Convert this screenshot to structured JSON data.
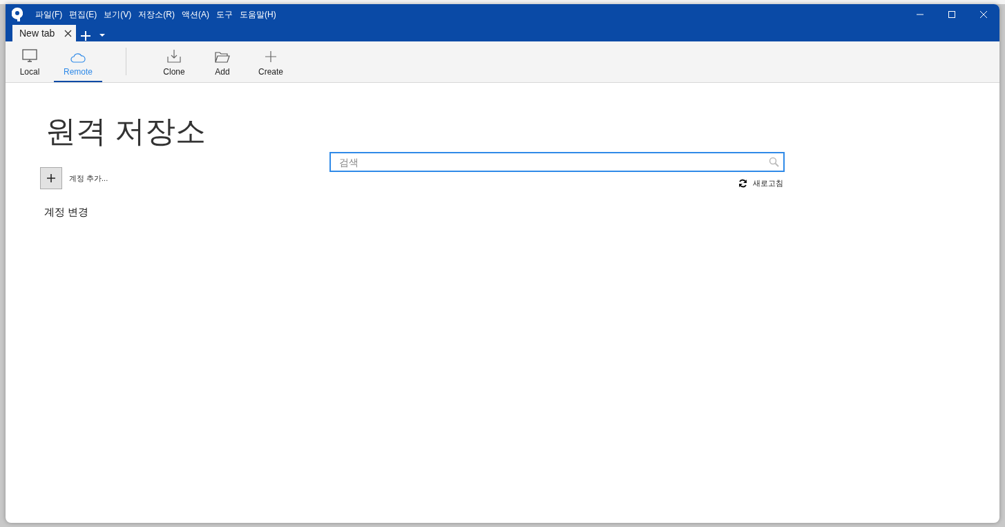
{
  "menu": [
    {
      "label": "파일(F)"
    },
    {
      "label": "편집(E)"
    },
    {
      "label": "보기(V)"
    },
    {
      "label": "저장소(R)"
    },
    {
      "label": "액션(A)"
    },
    {
      "label": "도구"
    },
    {
      "label": "도움말(H)"
    }
  ],
  "tabs": [
    {
      "label": "New tab",
      "selected": true
    }
  ],
  "toolbar": {
    "views": [
      {
        "label": "Local",
        "selected": false
      },
      {
        "label": "Remote",
        "selected": true
      }
    ],
    "actions": [
      {
        "label": "Clone"
      },
      {
        "label": "Add"
      },
      {
        "label": "Create"
      }
    ]
  },
  "page": {
    "title": "원격 저장소",
    "add_account": "계정 추가...",
    "section": "계정 변경",
    "search": {
      "placeholder": "검색"
    },
    "refresh": "새로고침"
  }
}
